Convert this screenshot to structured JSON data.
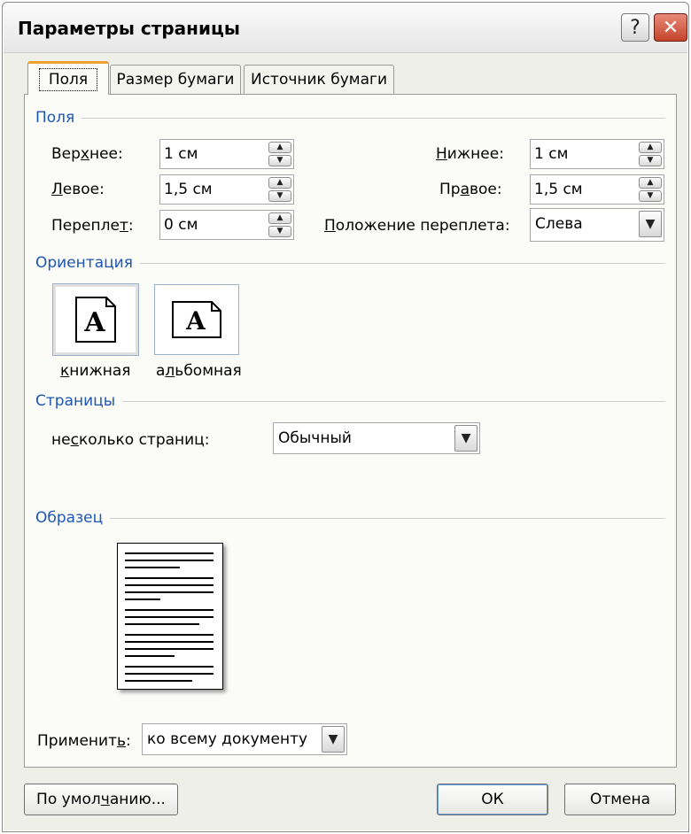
{
  "window": {
    "title": "Параметры страницы",
    "help_glyph": "?",
    "close_glyph": "✕"
  },
  "tabs": [
    {
      "label": "Поля",
      "active": true
    },
    {
      "label": "Размер бумаги",
      "active": false
    },
    {
      "label": "Источник бумаги",
      "active": false
    }
  ],
  "margins": {
    "section_label": "Поля",
    "top": {
      "label_pre": "Вер",
      "label_u": "х",
      "label_post": "нее:",
      "value": "1 см"
    },
    "bottom": {
      "label_pre": "",
      "label_u": "Н",
      "label_post": "ижнее:",
      "value": "1 см"
    },
    "left": {
      "label_pre": "",
      "label_u": "Л",
      "label_post": "евое:",
      "value": "1,5 см"
    },
    "right": {
      "label_pre": "Пр",
      "label_u": "а",
      "label_post": "вое:",
      "value": "1,5 см"
    },
    "gutter": {
      "label_pre": "Перепле",
      "label_u": "т",
      "label_post": ":",
      "value": "0 см"
    },
    "gutter_pos": {
      "label_pre": "",
      "label_u": "П",
      "label_post": "оложение переплета:",
      "value": "Слева"
    }
  },
  "orientation": {
    "section_label": "Ориентация",
    "portrait": {
      "label_pre": "",
      "label_u": "к",
      "label_post": "нижная",
      "glyph": "A",
      "selected": true
    },
    "landscape": {
      "label_pre": "а",
      "label_u": "л",
      "label_post": "ьбомная",
      "glyph": "A",
      "selected": false
    }
  },
  "pages": {
    "section_label": "Страницы",
    "multiple_label_pre": "не",
    "multiple_label_u": "с",
    "multiple_label_post": "колько страниц:",
    "multiple_value": "Обычный"
  },
  "preview": {
    "section_label": "Образец"
  },
  "apply": {
    "label_pre": "Применит",
    "label_u": "ь",
    "label_post": ":",
    "value": "ко всему документу"
  },
  "buttons": {
    "default_pre": "По умол",
    "default_u": "ч",
    "default_post": "анию...",
    "ok": "ОК",
    "cancel": "Отмена"
  },
  "icons": {
    "spin_up": "▲",
    "spin_down": "▼",
    "dropdown": "▼"
  }
}
